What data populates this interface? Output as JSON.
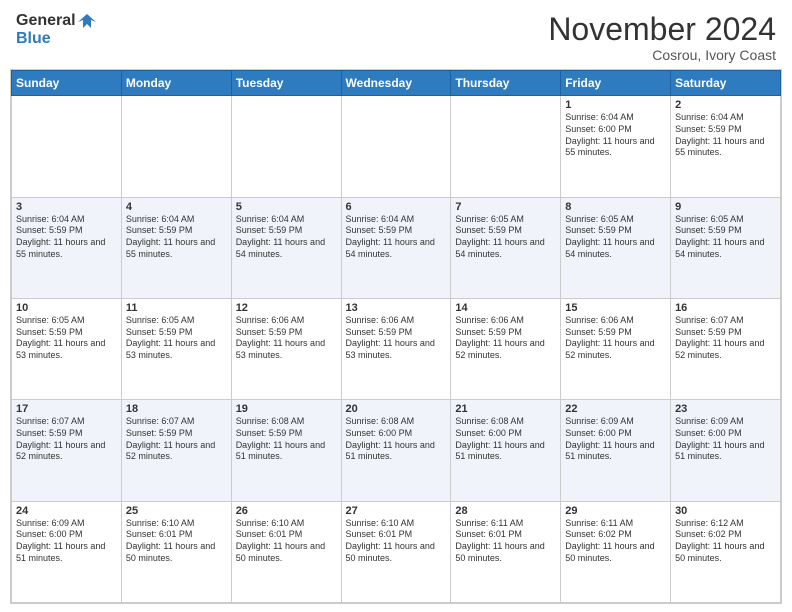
{
  "header": {
    "logo_general": "General",
    "logo_blue": "Blue",
    "month_title": "November 2024",
    "location": "Cosrou, Ivory Coast"
  },
  "weekdays": [
    "Sunday",
    "Monday",
    "Tuesday",
    "Wednesday",
    "Thursday",
    "Friday",
    "Saturday"
  ],
  "weeks": [
    [
      {
        "day": "",
        "info": ""
      },
      {
        "day": "",
        "info": ""
      },
      {
        "day": "",
        "info": ""
      },
      {
        "day": "",
        "info": ""
      },
      {
        "day": "",
        "info": ""
      },
      {
        "day": "1",
        "info": "Sunrise: 6:04 AM\nSunset: 6:00 PM\nDaylight: 11 hours and 55 minutes."
      },
      {
        "day": "2",
        "info": "Sunrise: 6:04 AM\nSunset: 5:59 PM\nDaylight: 11 hours and 55 minutes."
      }
    ],
    [
      {
        "day": "3",
        "info": "Sunrise: 6:04 AM\nSunset: 5:59 PM\nDaylight: 11 hours and 55 minutes."
      },
      {
        "day": "4",
        "info": "Sunrise: 6:04 AM\nSunset: 5:59 PM\nDaylight: 11 hours and 55 minutes."
      },
      {
        "day": "5",
        "info": "Sunrise: 6:04 AM\nSunset: 5:59 PM\nDaylight: 11 hours and 54 minutes."
      },
      {
        "day": "6",
        "info": "Sunrise: 6:04 AM\nSunset: 5:59 PM\nDaylight: 11 hours and 54 minutes."
      },
      {
        "day": "7",
        "info": "Sunrise: 6:05 AM\nSunset: 5:59 PM\nDaylight: 11 hours and 54 minutes."
      },
      {
        "day": "8",
        "info": "Sunrise: 6:05 AM\nSunset: 5:59 PM\nDaylight: 11 hours and 54 minutes."
      },
      {
        "day": "9",
        "info": "Sunrise: 6:05 AM\nSunset: 5:59 PM\nDaylight: 11 hours and 54 minutes."
      }
    ],
    [
      {
        "day": "10",
        "info": "Sunrise: 6:05 AM\nSunset: 5:59 PM\nDaylight: 11 hours and 53 minutes."
      },
      {
        "day": "11",
        "info": "Sunrise: 6:05 AM\nSunset: 5:59 PM\nDaylight: 11 hours and 53 minutes."
      },
      {
        "day": "12",
        "info": "Sunrise: 6:06 AM\nSunset: 5:59 PM\nDaylight: 11 hours and 53 minutes."
      },
      {
        "day": "13",
        "info": "Sunrise: 6:06 AM\nSunset: 5:59 PM\nDaylight: 11 hours and 53 minutes."
      },
      {
        "day": "14",
        "info": "Sunrise: 6:06 AM\nSunset: 5:59 PM\nDaylight: 11 hours and 52 minutes."
      },
      {
        "day": "15",
        "info": "Sunrise: 6:06 AM\nSunset: 5:59 PM\nDaylight: 11 hours and 52 minutes."
      },
      {
        "day": "16",
        "info": "Sunrise: 6:07 AM\nSunset: 5:59 PM\nDaylight: 11 hours and 52 minutes."
      }
    ],
    [
      {
        "day": "17",
        "info": "Sunrise: 6:07 AM\nSunset: 5:59 PM\nDaylight: 11 hours and 52 minutes."
      },
      {
        "day": "18",
        "info": "Sunrise: 6:07 AM\nSunset: 5:59 PM\nDaylight: 11 hours and 52 minutes."
      },
      {
        "day": "19",
        "info": "Sunrise: 6:08 AM\nSunset: 5:59 PM\nDaylight: 11 hours and 51 minutes."
      },
      {
        "day": "20",
        "info": "Sunrise: 6:08 AM\nSunset: 6:00 PM\nDaylight: 11 hours and 51 minutes."
      },
      {
        "day": "21",
        "info": "Sunrise: 6:08 AM\nSunset: 6:00 PM\nDaylight: 11 hours and 51 minutes."
      },
      {
        "day": "22",
        "info": "Sunrise: 6:09 AM\nSunset: 6:00 PM\nDaylight: 11 hours and 51 minutes."
      },
      {
        "day": "23",
        "info": "Sunrise: 6:09 AM\nSunset: 6:00 PM\nDaylight: 11 hours and 51 minutes."
      }
    ],
    [
      {
        "day": "24",
        "info": "Sunrise: 6:09 AM\nSunset: 6:00 PM\nDaylight: 11 hours and 51 minutes."
      },
      {
        "day": "25",
        "info": "Sunrise: 6:10 AM\nSunset: 6:01 PM\nDaylight: 11 hours and 50 minutes."
      },
      {
        "day": "26",
        "info": "Sunrise: 6:10 AM\nSunset: 6:01 PM\nDaylight: 11 hours and 50 minutes."
      },
      {
        "day": "27",
        "info": "Sunrise: 6:10 AM\nSunset: 6:01 PM\nDaylight: 11 hours and 50 minutes."
      },
      {
        "day": "28",
        "info": "Sunrise: 6:11 AM\nSunset: 6:01 PM\nDaylight: 11 hours and 50 minutes."
      },
      {
        "day": "29",
        "info": "Sunrise: 6:11 AM\nSunset: 6:02 PM\nDaylight: 11 hours and 50 minutes."
      },
      {
        "day": "30",
        "info": "Sunrise: 6:12 AM\nSunset: 6:02 PM\nDaylight: 11 hours and 50 minutes."
      }
    ]
  ]
}
